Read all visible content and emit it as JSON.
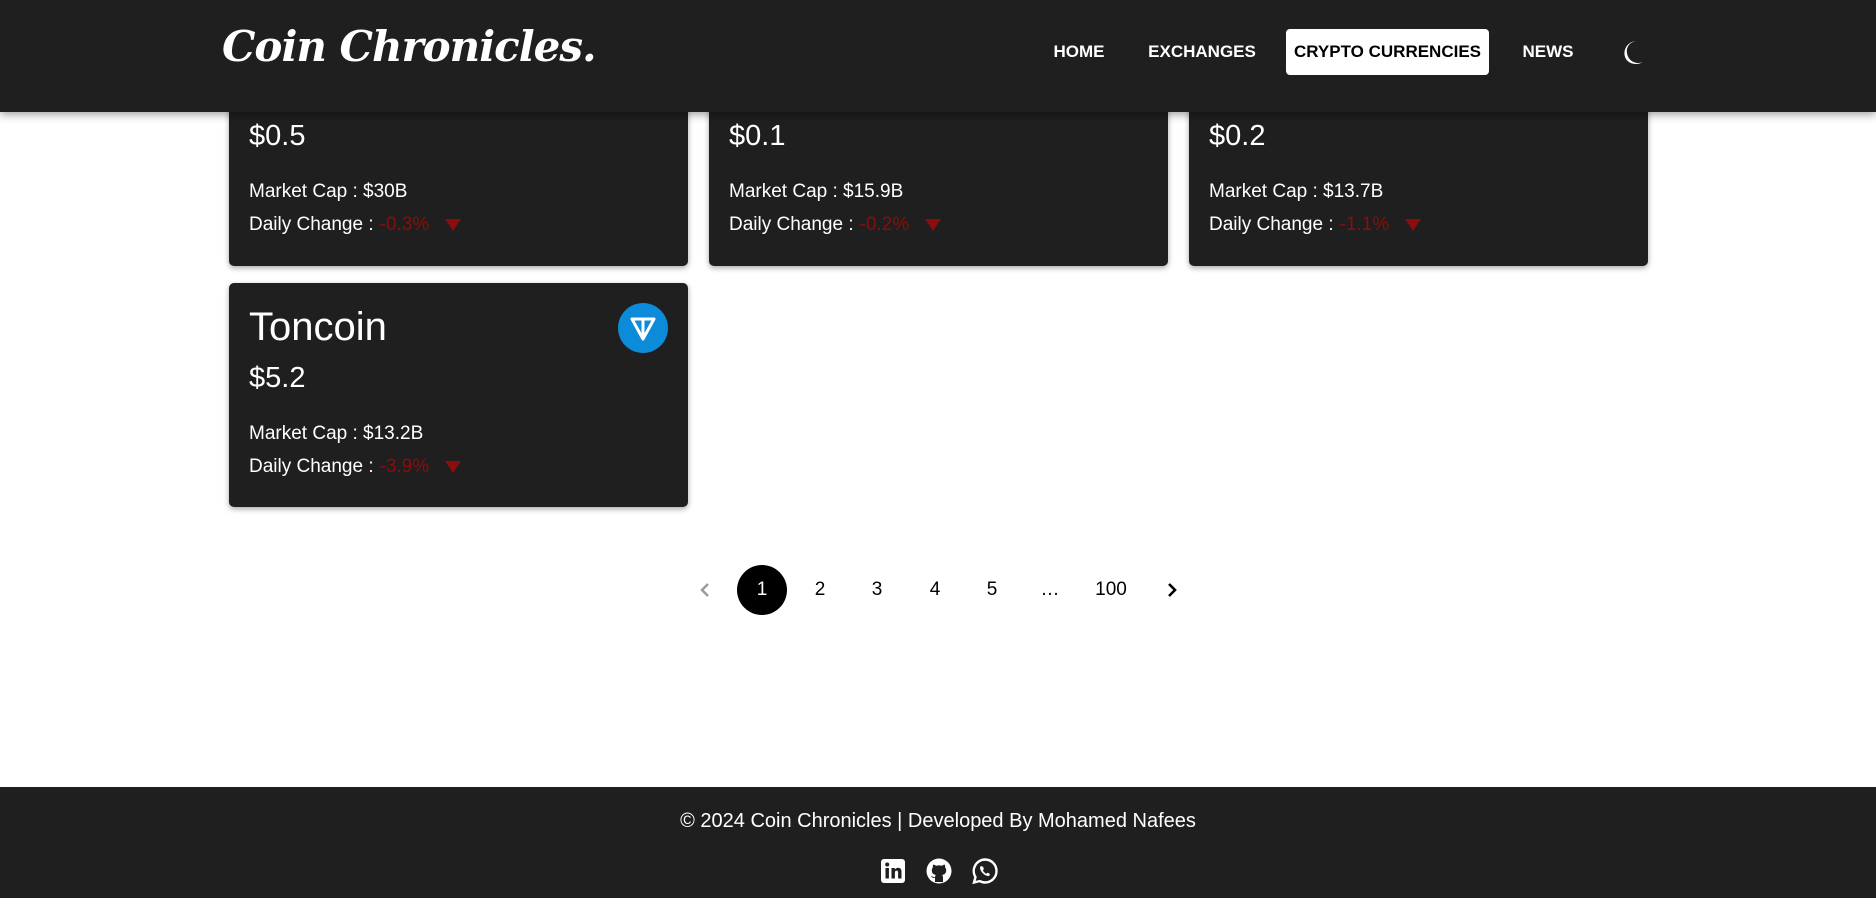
{
  "header": {
    "logo": "Coin Chronicles.",
    "nav": [
      "HOME",
      "EXCHANGES",
      "CRYPTO CURRENCIES",
      "NEWS"
    ],
    "active_nav": "CRYPTO CURRENCIES",
    "theme_icon": "moon-icon"
  },
  "cards": [
    {
      "price": "$0.5",
      "market_cap": "Market Cap : $30B",
      "daily_label": "Daily Change :",
      "daily_change": "-0.3%"
    },
    {
      "price": "$0.1",
      "market_cap": "Market Cap : $15.9B",
      "daily_label": "Daily Change :",
      "daily_change": "-0.2%"
    },
    {
      "price": "$0.2",
      "market_cap": "Market Cap : $13.7B",
      "daily_label": "Daily Change :",
      "daily_change": "-1.1%"
    },
    {
      "name": "Toncoin",
      "price": "$5.2",
      "market_cap": "Market Cap : $13.2B",
      "daily_label": "Daily Change :",
      "daily_change": "-3.9%",
      "logo_icon": "toncoin-logo-icon"
    }
  ],
  "pagination": {
    "pages": [
      "1",
      "2",
      "3",
      "4",
      "5",
      "…",
      "100"
    ],
    "current": "1"
  },
  "footer": {
    "text": "© 2024 Coin Chronicles | Developed By Mohamed Nafees",
    "social_icons": [
      "linkedin-icon",
      "github-icon",
      "whatsapp-icon"
    ]
  },
  "colors": {
    "surface": "#1f1f1f",
    "negative": "#8b0d0d",
    "toncoin_blue": "#0b8bd8"
  }
}
